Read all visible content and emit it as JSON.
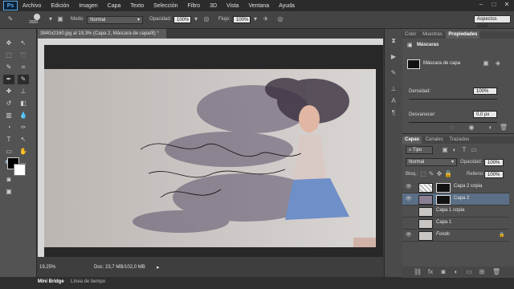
{
  "menu": {
    "logo": "Ps",
    "items": [
      "Archivo",
      "Edición",
      "Imagen",
      "Capa",
      "Texto",
      "Selección",
      "Filtro",
      "3D",
      "Vista",
      "Ventana",
      "Ayuda"
    ]
  },
  "options": {
    "brush_size": "2600",
    "mode_label": "Modo:",
    "mode_value": "Normal",
    "opacity_label": "Opacidad:",
    "opacity_value": "100%",
    "flow_label": "Flujo:",
    "flow_value": "100%",
    "workspace": "Aspectos esen..."
  },
  "document": {
    "tab_title": "3840x2160.jpg al 19,3% (Capa 2, Máscara de capa/8) *",
    "zoom": "19,25%",
    "doc_info": "Doc: 23,7 MB/102,0 MB"
  },
  "bottom_tabs": [
    "Mini Bridge",
    "Línea de tiempo"
  ],
  "properties": {
    "tabs": [
      "Color",
      "Muestras",
      "Propiedades"
    ],
    "section": "Máscaras",
    "mask_label": "Máscara de capa",
    "density_label": "Densidad:",
    "density_value": "100%",
    "feather_label": "Desvanecer:",
    "feather_value": "0,0 px"
  },
  "layers": {
    "tabs": [
      "Capas",
      "Canales",
      "Trazados"
    ],
    "filter_value": "Tipo",
    "blend_value": "Normal",
    "opacity_label": "Opacidad:",
    "opacity_value": "100%",
    "lock_label": "Bloq.:",
    "fill_label": "Relleno:",
    "fill_value": "100%",
    "items": [
      {
        "name": "Capa 2 copia"
      },
      {
        "name": "Capa 2"
      },
      {
        "name": "Capa 1 copia"
      },
      {
        "name": "Capa 1"
      },
      {
        "name": "Fondo"
      }
    ]
  },
  "colors": {
    "accent": "#5aa7e6",
    "selected_layer": "#5b6f86"
  }
}
